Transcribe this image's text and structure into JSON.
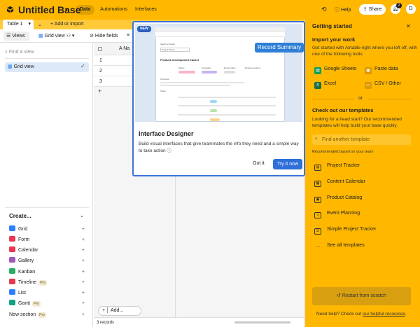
{
  "header": {
    "base_name": "Untitled Base",
    "tabs": [
      "Data",
      "Automations",
      "Interfaces"
    ],
    "help_label": "Help",
    "share_label": "Share",
    "notification_count": "2",
    "avatar_initial": "D",
    "brand_color": "#ffb700"
  },
  "table_tabs": {
    "current": "Table 1",
    "add_label": "+ Add or import"
  },
  "toolbar": {
    "views_label": "Views",
    "grid_view_label": "Grid view",
    "hide_fields_label": "Hide fields"
  },
  "sidebar": {
    "find_placeholder": "Find a view",
    "current_view": "Grid view",
    "create_title": "Create...",
    "create_items": [
      {
        "label": "Grid",
        "color": "#2d7ff9",
        "pro": false
      },
      {
        "label": "Form",
        "color": "#e8384f",
        "pro": false
      },
      {
        "label": "Calendar",
        "color": "#e8384f",
        "pro": false
      },
      {
        "label": "Gallery",
        "color": "#9b59b6",
        "pro": false
      },
      {
        "label": "Kanban",
        "color": "#27ae60",
        "pro": false
      },
      {
        "label": "Timeline",
        "color": "#e8384f",
        "pro": true
      },
      {
        "label": "List",
        "color": "#2d7ff9",
        "pro": false
      },
      {
        "label": "Gantt",
        "color": "#16a085",
        "pro": true
      },
      {
        "label": "New section",
        "color": "",
        "pro": true
      }
    ],
    "pro_label": "Pro"
  },
  "grid": {
    "name_col": "Na",
    "rows": [
      "1",
      "2",
      "3"
    ],
    "add_label": "Add...",
    "record_count": "3 records"
  },
  "popover": {
    "new_badge": "NEW",
    "record_summary_label": "Record Summary",
    "title": "Interface Designer",
    "description": "Build visual interfaces that give teammates the info they need and a simple way to take action",
    "got_it_label": "Got it",
    "try_label": "Try it now",
    "mock": {
      "select_label": "Select a Project",
      "project_value": "Project Picker",
      "heading": "Product development tracker",
      "cols": [
        "Status",
        "Campaign",
        "Responsible",
        "Review required"
      ],
      "overview": "Overview",
      "tasks": "Tasks"
    }
  },
  "panel": {
    "title": "Getting started",
    "import_title": "Import your work",
    "import_desc": "Get started with Airtable right where you left off, with one of the following tools:",
    "import_items": [
      "Google Sheets",
      "Paste data",
      "Excel",
      "CSV / Other"
    ],
    "or_label": "or",
    "templates_title": "Check out our templates",
    "templates_desc": "Looking for a head start? Our recommended templates will help build your base quickly.",
    "search_placeholder": "Find another template",
    "recommended_label": "Recommended based on your team",
    "templates": [
      "Project Tracker",
      "Content Calendar",
      "Product Catalog",
      "Event Planning",
      "Simple Project Tracker",
      "See all templates"
    ],
    "restart_label": "Restart from scratch",
    "help_prefix": "Need help? Check out ",
    "help_link": "our helpful resources",
    "help_suffix": "."
  }
}
